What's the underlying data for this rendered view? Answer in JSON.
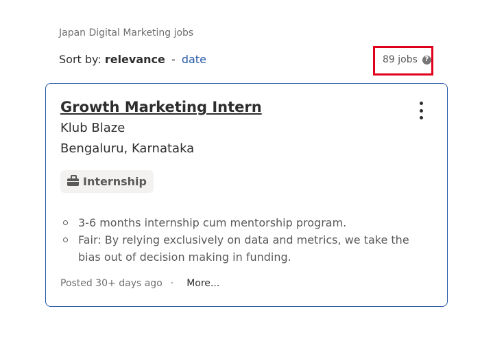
{
  "breadcrumb": "Japan Digital Marketing jobs",
  "sort": {
    "label": "Sort by:",
    "active": "relevance",
    "separator": "-",
    "alt": "date"
  },
  "results": {
    "count": "89 jobs",
    "help_icon": "question-circle-icon"
  },
  "job": {
    "title": "Growth Marketing Intern",
    "company": "Klub Blaze",
    "location": "Bengaluru, Karnataka",
    "job_type": "Internship",
    "job_type_icon": "briefcase-icon",
    "menu_icon": "kebab-menu-icon",
    "snippet": [
      "3-6 months internship cum mentorship program.",
      "Fair: By relying exclusively on data and metrics, we take the bias out of decision making in funding."
    ],
    "posted": "Posted 30+ days ago",
    "dot": "·",
    "more": "More..."
  },
  "colors": {
    "link": "#2557a7",
    "highlight": "#e0001b",
    "card_border": "#2557a7"
  }
}
